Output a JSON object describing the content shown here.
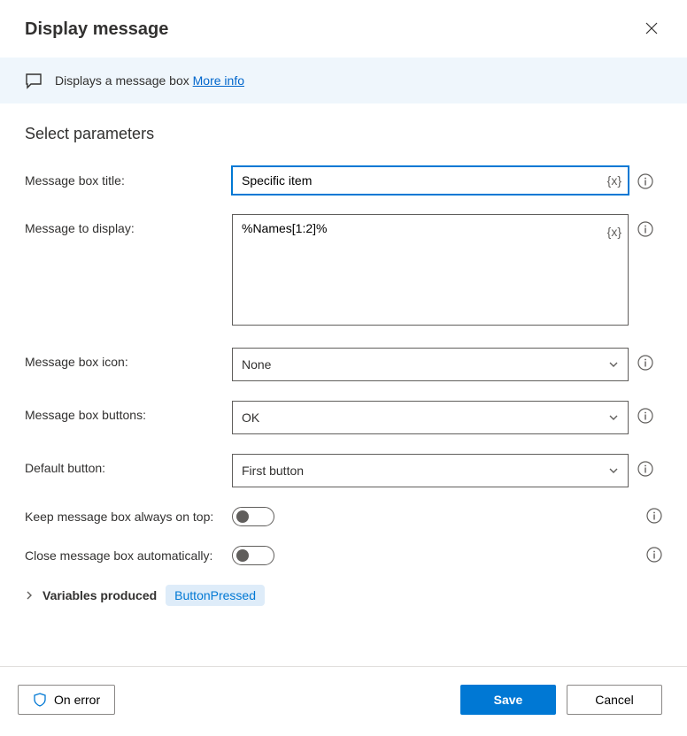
{
  "header": {
    "title": "Display message"
  },
  "info_bar": {
    "description": "Displays a message box",
    "more_info": "More info"
  },
  "section_title": "Select parameters",
  "params": {
    "title_label": "Message box title:",
    "title_value": "Specific item",
    "message_label": "Message to display:",
    "message_value": "%Names[1:2]%",
    "icon_label": "Message box icon:",
    "icon_value": "None",
    "buttons_label": "Message box buttons:",
    "buttons_value": "OK",
    "default_btn_label": "Default button:",
    "default_btn_value": "First button",
    "always_top_label": "Keep message box always on top:",
    "auto_close_label": "Close message box automatically:",
    "var_token": "{x}"
  },
  "variables": {
    "label": "Variables produced",
    "chip": "ButtonPressed"
  },
  "footer": {
    "on_error": "On error",
    "save": "Save",
    "cancel": "Cancel"
  }
}
